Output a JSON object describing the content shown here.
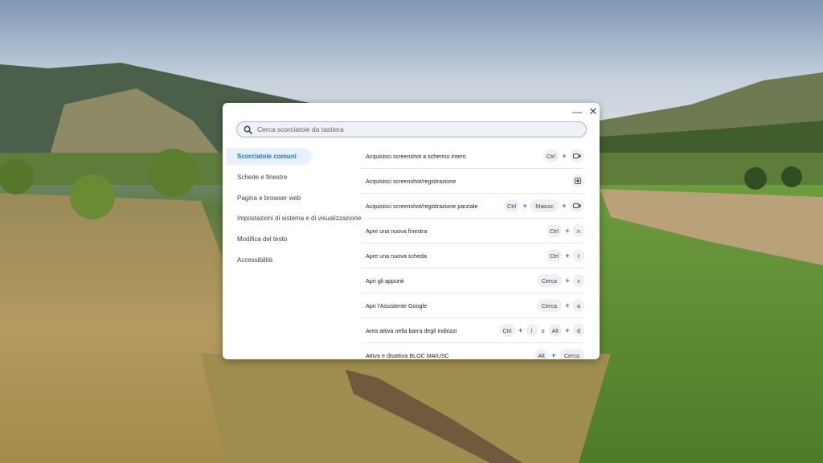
{
  "dialog": {
    "minimize_icon": "minimize-icon",
    "close_icon": "close-icon",
    "search": {
      "placeholder": "Cerca scorciatoie da tastiera",
      "icon": "search-icon"
    },
    "sidebar": {
      "items": [
        {
          "label": "Scorciatoie comuni",
          "active": true
        },
        {
          "label": "Schede e finestre"
        },
        {
          "label": "Pagina e browser web"
        },
        {
          "label": "Impostazioni di sistema e di visualizzazione"
        },
        {
          "label": "Modifica del testo"
        },
        {
          "label": "Accessibilità"
        }
      ]
    },
    "shortcuts": [
      {
        "label": "Acquisisci screenshot a schermo intero",
        "keys": [
          "Ctrl",
          "+",
          "screenshot-window-icon"
        ]
      },
      {
        "label": "Acquisisci screenshot/registrazione",
        "keys": [
          "screen-capture-key-icon"
        ]
      },
      {
        "label": "Acquisisci screenshot/registrazione parziale",
        "keys": [
          "Ctrl",
          "+",
          "Maiusc",
          "+",
          "screenshot-window-icon"
        ]
      },
      {
        "label": "Apre una nuova finestra",
        "keys": [
          "Ctrl",
          "+",
          "n"
        ]
      },
      {
        "label": "Apre una nuova scheda",
        "keys": [
          "Ctrl",
          "+",
          "t"
        ]
      },
      {
        "label": "Apri gli appunti",
        "keys": [
          "Cerca",
          "+",
          "v"
        ]
      },
      {
        "label": "Apri l'Assistente Google",
        "keys": [
          "Cerca",
          "+",
          "a"
        ]
      },
      {
        "label": "Area attiva nella barra degli indirizzi",
        "keys": [
          "Ctrl",
          "+",
          "l",
          "o",
          "Alt",
          "+",
          "d"
        ]
      },
      {
        "label": "Attiva e disattiva BLOC MAIUSC",
        "keys": [
          "Alt",
          "+",
          "Cerca"
        ]
      }
    ],
    "accent_color": "#1a73e8"
  }
}
